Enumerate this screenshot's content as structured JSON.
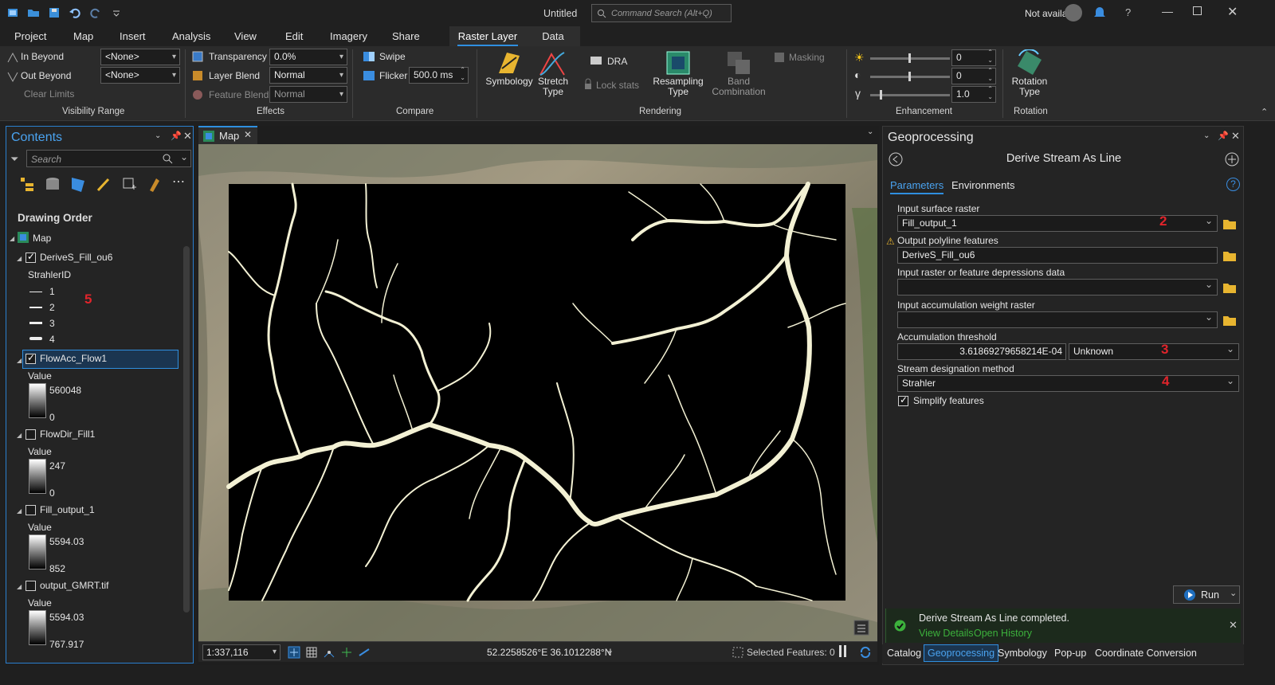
{
  "window": {
    "title": "Untitled",
    "command_search_placeholder": "Command Search (Alt+Q)",
    "account": "Not available"
  },
  "menu": {
    "tabs": [
      "Project",
      "Map",
      "Insert",
      "Analysis",
      "View",
      "Edit",
      "Imagery",
      "Share",
      "Raster Layer",
      "Data"
    ],
    "active": "Raster Layer"
  },
  "ribbon": {
    "visibility": {
      "in_beyond": "In Beyond",
      "out_beyond": "Out Beyond",
      "clear_limits": "Clear Limits",
      "in_value": "<None>",
      "out_value": "<None>",
      "group": "Visibility Range"
    },
    "effects": {
      "transparency": "Transparency",
      "transparency_value": "0.0%",
      "layer_blend": "Layer Blend",
      "layer_blend_value": "Normal",
      "feature_blend": "Feature Blend",
      "feature_blend_value": "Normal",
      "group": "Effects"
    },
    "compare": {
      "swipe": "Swipe",
      "flicker": "Flicker",
      "flicker_value": "500.0  ms",
      "group": "Compare"
    },
    "rendering": {
      "symbology": "Symbology",
      "stretch": "Stretch",
      "stretch2": "Type",
      "dra": "DRA",
      "lock_stats": "Lock stats",
      "resampling": "Resampling",
      "resampling2": "Type",
      "band": "Band",
      "band2": "Combination",
      "masking": "Masking",
      "group": "Rendering"
    },
    "enhancement": {
      "brightness": "0",
      "contrast": "0",
      "gamma": "1.0",
      "group": "Enhancement"
    },
    "rotation": {
      "label": "Rotation",
      "label2": "Type",
      "group": "Rotation"
    }
  },
  "contents": {
    "title": "Contents",
    "search_placeholder": "Search",
    "drawing_order": "Drawing Order",
    "map": "Map",
    "layers": {
      "derive": {
        "name": "DeriveS_Fill_ou6",
        "field": "StrahlerID",
        "classes": [
          "1",
          "2",
          "3",
          "4"
        ],
        "annot": "5"
      },
      "flowacc": {
        "name": "FlowAcc_Flow1",
        "value": "Value",
        "hi": "560048",
        "lo": "0"
      },
      "flowdir": {
        "name": "FlowDir_Fill1",
        "value": "Value",
        "hi": "247",
        "lo": "0"
      },
      "fill": {
        "name": "Fill_output_1",
        "value": "Value",
        "hi": "5594.03",
        "lo": "852"
      },
      "gmrt": {
        "name": "output_GMRT.tif",
        "value": "Value",
        "hi": "5594.03",
        "lo": "767.917"
      }
    }
  },
  "map": {
    "tab": "Map",
    "scale": "1:337,116",
    "coords": "52.2258526°E 36.1012288°N",
    "selected": "Selected Features: 0"
  },
  "geoprocessing": {
    "title": "Geoprocessing",
    "tool": "Derive Stream As Line",
    "tab_params": "Parameters",
    "tab_env": "Environments",
    "input_surface_label": "Input surface raster",
    "input_surface_value": "Fill_output_1",
    "output_label": "Output polyline features",
    "output_value": "DeriveS_Fill_ou6",
    "depressions_label": "Input raster or feature depressions data",
    "weight_label": "Input accumulation weight raster",
    "threshold_label": "Accumulation threshold",
    "threshold_value": "3.61869279658214E-04",
    "threshold_unit": "Unknown",
    "method_label": "Stream designation method",
    "method_value": "Strahler",
    "simplify_label": "Simplify features",
    "annotations": [
      "2",
      "3",
      "4"
    ],
    "run": "Run",
    "message": "Derive Stream As Line completed.",
    "view_details": "View Details",
    "open_history": "Open History",
    "bottom_tabs": [
      "Catalog",
      "Geoprocessing",
      "Symbology",
      "Pop-up",
      "Coordinate Conversion"
    ]
  },
  "colors": {
    "accent": "#2f8fe0",
    "stream": "#f3f1d4",
    "annotation": "#e0242b",
    "success": "#3cb13c"
  }
}
